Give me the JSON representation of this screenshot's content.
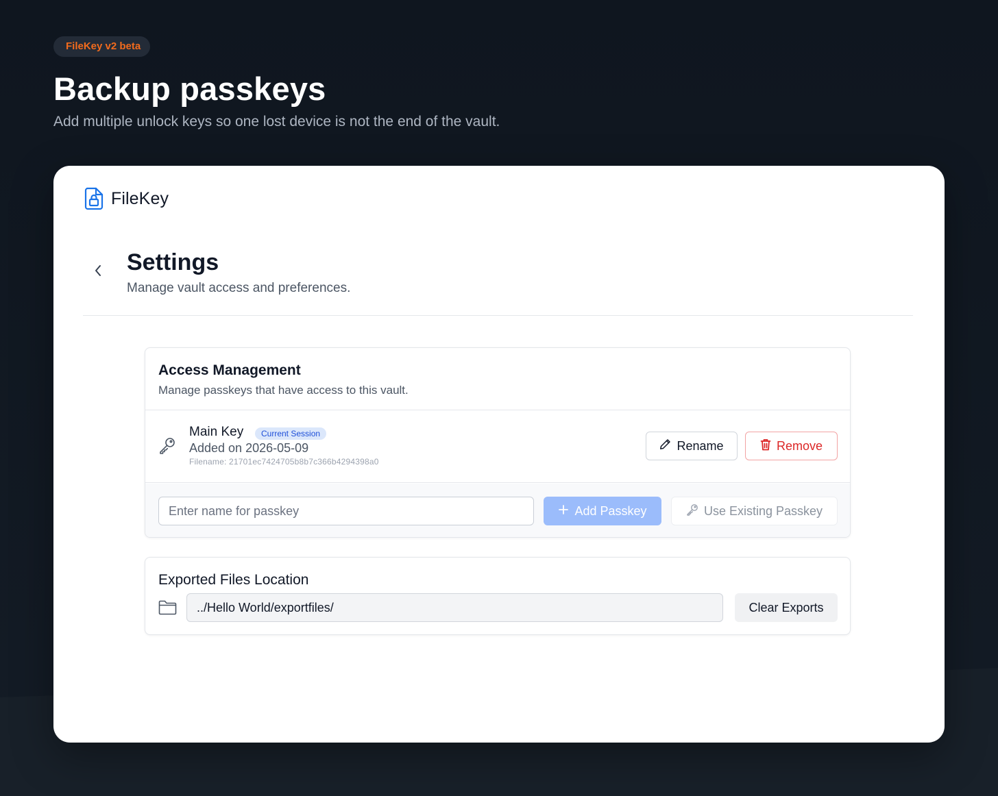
{
  "hero": {
    "badge": "FileKey v2 beta",
    "title": "Backup passkeys",
    "subtitle": "Add multiple unlock keys so one lost device is not the end of the vault."
  },
  "app": {
    "brand_name": "FileKey",
    "brand_color": "#1a73e8",
    "page_title": "Settings",
    "page_subtitle": "Manage vault access and preferences."
  },
  "access": {
    "title": "Access Management",
    "subtitle": "Manage passkeys that have access to this vault.",
    "keys": [
      {
        "name": "Main Key",
        "badge": "Current Session",
        "added": "Added on 2026-05-09",
        "filename": "Filename: 21701ec7424705b8b7c366b4294398a0",
        "rename_label": "Rename",
        "remove_label": "Remove"
      }
    ],
    "name_input_placeholder": "Enter name for passkey",
    "name_input_value": "",
    "add_label": "Add Passkey",
    "existing_label": "Use Existing Passkey"
  },
  "exports": {
    "title": "Exported Files Location",
    "path": "../Hello World/exportfiles/",
    "clear_label": "Clear Exports"
  },
  "icons": {
    "brand": "file-lock-icon",
    "back": "chevron-left-icon",
    "key": "key-icon",
    "rename": "pencil-icon",
    "remove": "trash-icon",
    "add": "plus-icon",
    "existing": "key-icon",
    "folder": "folder-icon"
  },
  "colors": {
    "accent": "#f26b1d",
    "danger": "#dc2626",
    "primary_disabled": "#9bbcfb",
    "badge_bg": "#dbe7fb",
    "badge_text": "#1d4ed8"
  }
}
